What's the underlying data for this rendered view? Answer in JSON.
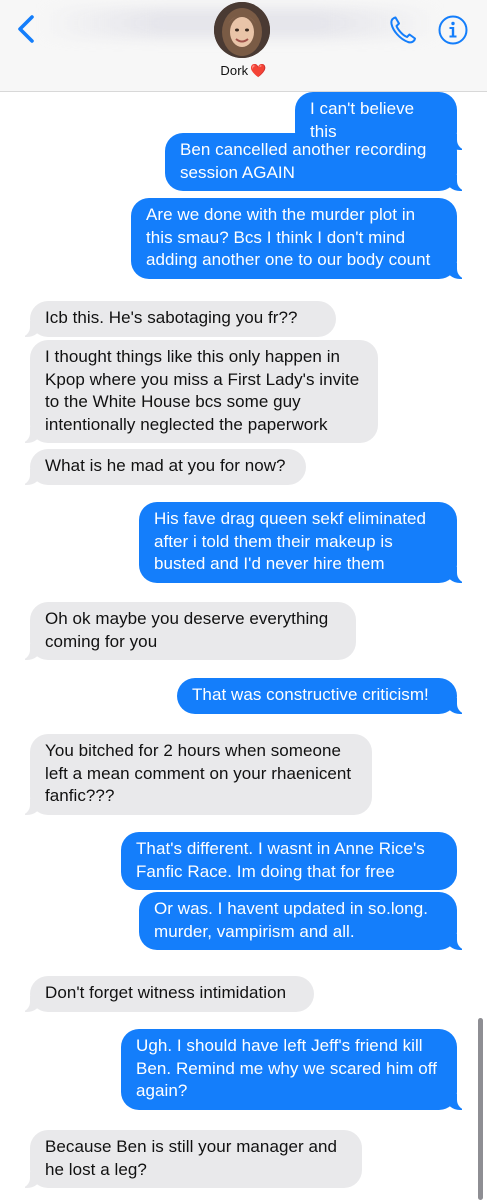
{
  "header": {
    "contact_name": "Dork",
    "contact_emoji": "❤️",
    "icons": {
      "back": "chevron-left-icon",
      "phone": "phone-icon",
      "info": "info-icon"
    },
    "accent_color": "#147efb"
  },
  "messages": [
    {
      "from": "me",
      "text": "I can't believe this"
    },
    {
      "from": "me",
      "text": "Ben cancelled another recording session AGAIN"
    },
    {
      "from": "me",
      "text": "Are we done with the murder plot in this smau? Bcs I think I don't mind adding another one to our body count"
    },
    {
      "from": "them",
      "text": "Icb this. He's sabotaging you fr??"
    },
    {
      "from": "them",
      "text": "I thought things like this only happen in Kpop where you miss a First Lady's invite to the White House bcs some guy intentionally neglected the paperwork"
    },
    {
      "from": "them",
      "text": "What is he mad at you for now?"
    },
    {
      "from": "me",
      "text": "His fave drag queen sekf eliminated after i told them their makeup is busted and I'd never hire them"
    },
    {
      "from": "them",
      "text": "Oh ok maybe you deserve everything coming for you"
    },
    {
      "from": "me",
      "text": "That was constructive criticism!"
    },
    {
      "from": "them",
      "text": "You bitched for 2 hours when someone left a mean comment on your rhaenicent fanfic???"
    },
    {
      "from": "me",
      "text": "That's different. I wasnt in Anne Rice's Fanfic Race. Im doing that for free"
    },
    {
      "from": "me",
      "text": "Or was. I havent updated in so.long. murder, vampirism and all."
    },
    {
      "from": "them",
      "text": "Don't forget witness intimidation"
    },
    {
      "from": "me",
      "text": "Ugh. I should have left Jeff's friend kill Ben. Remind me why we scared him off again?"
    },
    {
      "from": "them",
      "text": "Because Ben is still your manager and he lost a leg?"
    }
  ],
  "colors": {
    "outgoing_bubble": "#147efb",
    "incoming_bubble": "#e9e9eb"
  }
}
